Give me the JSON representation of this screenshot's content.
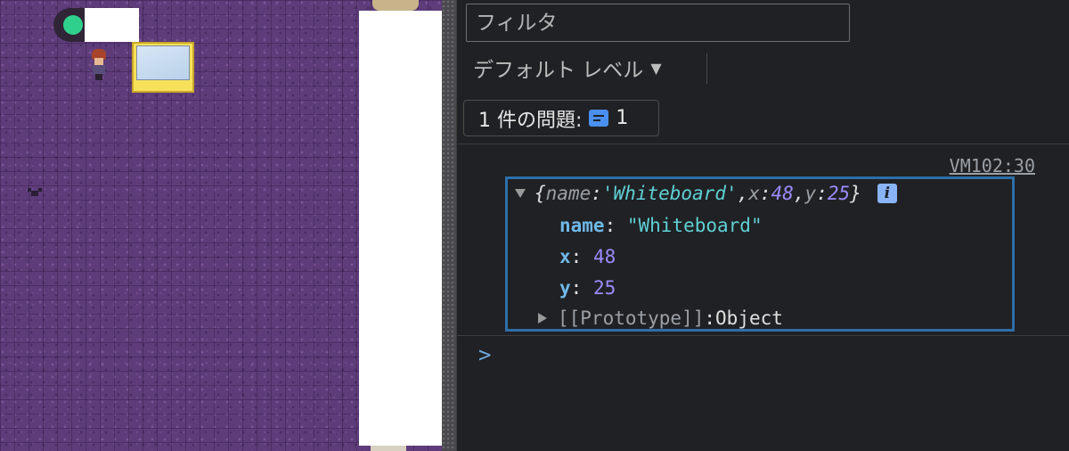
{
  "console": {
    "filter": {
      "placeholder": "フィルタ",
      "value": ""
    },
    "level_select": {
      "label": "デフォルト レベル",
      "caret": "▼"
    },
    "issues": {
      "prefix": "1 件の問題:",
      "count": "1",
      "icon": "issue-message-icon"
    },
    "entry": {
      "source_link": "VM102:30",
      "summary": {
        "open_brace": "{",
        "name_key": "name",
        "name_value": "'Whiteboard'",
        "x_key": "x",
        "x_value": "48",
        "y_key": "y",
        "y_value": "25",
        "close_brace": "}"
      },
      "info_badge": "i",
      "properties": [
        {
          "key": "name",
          "value": "\"Whiteboard\""
        },
        {
          "key": "x",
          "value": "48"
        },
        {
          "key": "y",
          "value": "25"
        }
      ],
      "prototype": {
        "key": "[[Prototype]]",
        "value": "Object"
      }
    },
    "prompt_caret": ">"
  },
  "colors": {
    "console_bg": "#202124",
    "highlight_border": "#2d6fa8",
    "string": "#5ed0d5",
    "number": "#9b8cff",
    "key": "#6fb8e8",
    "game_floor": "#5e3c7a",
    "toggle_knob": "#2fd08c",
    "whiteboard_frame": "#f7e15a"
  }
}
